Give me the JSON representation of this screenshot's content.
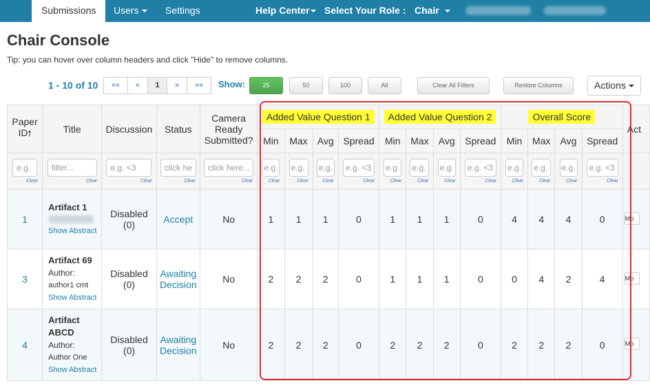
{
  "nav": {
    "submissions": "Submissions",
    "users": "Users",
    "settings": "Settings",
    "help_center": "Help Center",
    "select_role": "Select Your Role :",
    "role": "Chair"
  },
  "page": {
    "title": "Chair Console",
    "tip": "Tip: you can hover over column headers and click \"Hide\" to remove columns."
  },
  "pagination": {
    "range": "1 - 10 of 10",
    "first": "««",
    "prev": "«",
    "current": "1",
    "next": "»",
    "last": "»»",
    "show_label": "Show:",
    "sizes": [
      "25",
      "50",
      "100",
      "All"
    ],
    "clear_filters": "Clear All Filters",
    "restore_columns": "Restore Columns",
    "actions": "Actions"
  },
  "table": {
    "headers": {
      "paper_id": [
        "Paper",
        "ID"
      ],
      "title": "Title",
      "discussion": "Discussion",
      "status": "Status",
      "camera": [
        "Camera",
        "Ready",
        "Submitted?"
      ],
      "group1": "Added Value Question 1",
      "group2": "Added Value Question 2",
      "group3": "Overall Score",
      "sub": [
        "Min",
        "Max",
        "Avg",
        "Spread"
      ],
      "actions": "Act"
    },
    "filters": {
      "paper_id": "e.g. <",
      "title": "filter...",
      "discussion": "e.g. <3",
      "status": "click here",
      "camera": "click here...",
      "stat": "e.g.",
      "spread": "e.g. <3",
      "clear": "Clear"
    },
    "rows": [
      {
        "id": "1",
        "title": "Artifact 1",
        "author_label": "",
        "author_name": "",
        "show_abstract": "Show Abstract",
        "discussion": [
          "Disabled",
          "(0)"
        ],
        "status": [
          "Accept"
        ],
        "camera": "No",
        "scores": [
          "1",
          "1",
          "1",
          "0",
          "1",
          "1",
          "1",
          "0",
          "4",
          "4",
          "4",
          "0"
        ],
        "more": "Mo"
      },
      {
        "id": "3",
        "title": "Artifact 69",
        "author_label": "Author:",
        "author_name": "author1 cmt",
        "show_abstract": "Show Abstract",
        "discussion": [
          "Disabled",
          "(0)"
        ],
        "status": [
          "Awaiting",
          "Decision"
        ],
        "camera": "No",
        "scores": [
          "2",
          "2",
          "2",
          "0",
          "1",
          "1",
          "1",
          "0",
          "0",
          "4",
          "2",
          "4"
        ],
        "more": "Mo"
      },
      {
        "id": "4",
        "title": "Artifact ABCD",
        "author_label": "Author:",
        "author_name": "Author One",
        "show_abstract": "Show Abstract",
        "discussion": [
          "Disabled",
          "(0)"
        ],
        "status": [
          "Awaiting",
          "Decision"
        ],
        "camera": "No",
        "scores": [
          "2",
          "2",
          "2",
          "0",
          "2",
          "2",
          "2",
          "0",
          "2",
          "2",
          "2",
          "0"
        ],
        "more": "Mo"
      }
    ]
  },
  "colors": {
    "navbar": "#1f7fa6",
    "highlight": "#ffff33",
    "annotation_box": "#e0282e",
    "green_button": "#5cb85c"
  }
}
